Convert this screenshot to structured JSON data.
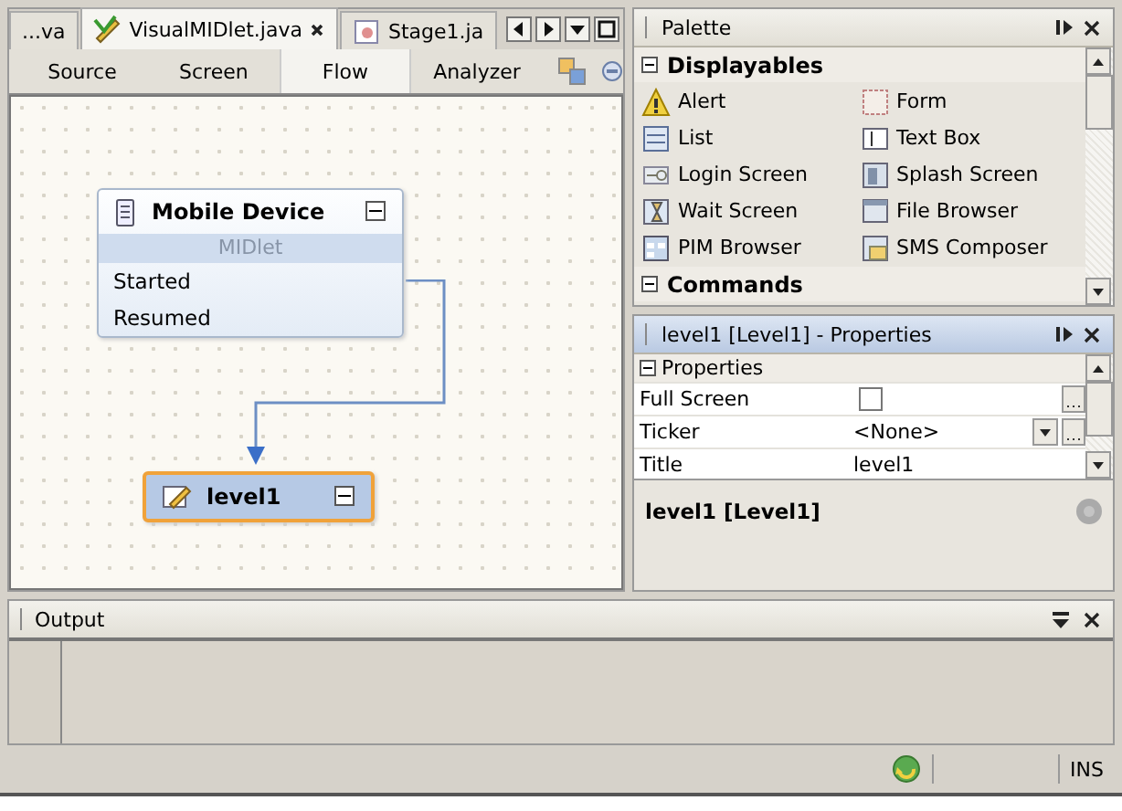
{
  "editor_tabs": [
    {
      "label": "...va",
      "selected": false,
      "closable": false
    },
    {
      "label": "VisualMIDlet.java",
      "selected": true,
      "closable": true
    },
    {
      "label": "Stage1.ja",
      "selected": false,
      "closable": false
    }
  ],
  "view_tabs": [
    {
      "label": "Source",
      "selected": false
    },
    {
      "label": "Screen",
      "selected": false
    },
    {
      "label": "Flow",
      "selected": true
    },
    {
      "label": "Analyzer",
      "selected": false
    }
  ],
  "flow": {
    "nodes": [
      {
        "kind": "device",
        "title": "Mobile Device",
        "subtitle": "MIDlet",
        "items": [
          "Started",
          "Resumed"
        ],
        "selected": false
      },
      {
        "kind": "screen",
        "title": "level1",
        "selected": true
      }
    ]
  },
  "palette": {
    "title": "Palette",
    "categories": [
      {
        "label": "Displayables",
        "expanded": true,
        "items": [
          "Alert",
          "Form",
          "List",
          "Text Box",
          "Login Screen",
          "Splash Screen",
          "Wait Screen",
          "File Browser",
          "PIM Browser",
          "SMS Composer"
        ]
      },
      {
        "label": "Commands",
        "expanded": true
      }
    ]
  },
  "properties": {
    "title": "level1 [Level1] - Properties",
    "section": {
      "label": "Properties",
      "expanded": true
    },
    "rows": [
      {
        "kind": "checkbox",
        "name": "Full Screen",
        "checked": false
      },
      {
        "kind": "dropdown",
        "name": "Ticker",
        "value": "<None>"
      },
      {
        "kind": "text",
        "name": "Title",
        "value": "level1"
      }
    ],
    "description": "level1 [Level1]"
  },
  "output": {
    "title": "Output"
  },
  "status_bar": {
    "mode": "INS"
  }
}
